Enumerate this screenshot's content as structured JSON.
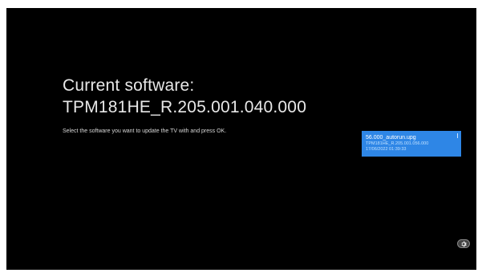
{
  "software": {
    "heading": "Current software:",
    "version": "TPM181HE_R.205.001.040.000",
    "instruction": "Select the software you want to update the TV with and press OK."
  },
  "file_list": {
    "items": [
      {
        "name": "56.000_autorun.upg",
        "version": "TPM181HE_R.205.001.056.000",
        "date": "17/06/2022 01:39:33",
        "selected": true
      }
    ],
    "selection_color": "#2e86e6"
  },
  "controls": {
    "settings_icon": "gear-icon"
  }
}
